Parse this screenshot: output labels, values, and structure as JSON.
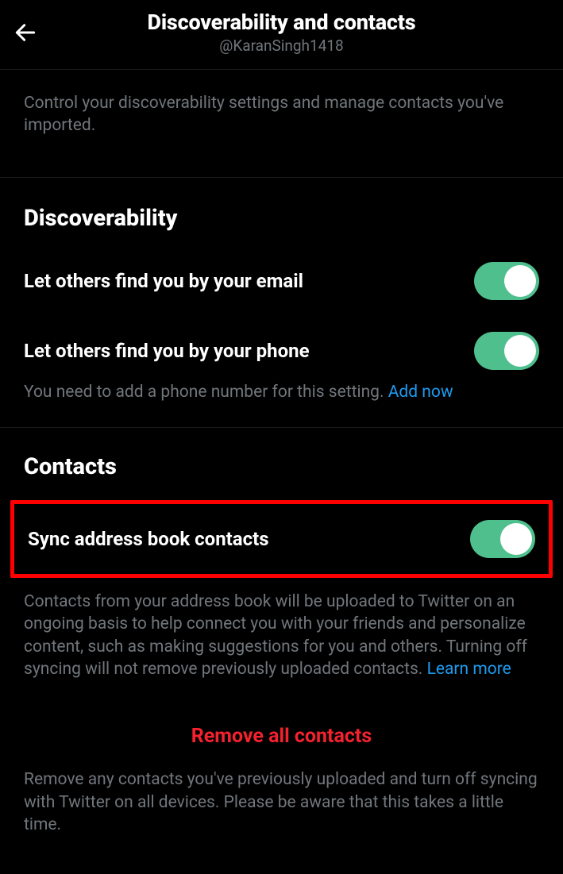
{
  "header": {
    "title": "Discoverability and contacts",
    "subtitle": "@KaranSingh1418"
  },
  "intro": "Control your discoverability settings and manage contacts you've imported.",
  "discoverability": {
    "title": "Discoverability",
    "email": {
      "label": "Let others find you by your email",
      "enabled": true
    },
    "phone": {
      "label": "Let others find you by your phone",
      "enabled": true,
      "helper_prefix": "You need to add a phone number for this setting. ",
      "helper_link": "Add now"
    }
  },
  "contacts": {
    "title": "Contacts",
    "sync": {
      "label": "Sync address book contacts",
      "enabled": true,
      "helper_prefix": "Contacts from your address book will be uploaded to Twitter on an ongoing basis to help connect you with your friends and personalize content, such as making suggestions for you and others. Turning off syncing will not remove previously uploaded contacts. ",
      "helper_link": "Learn more"
    },
    "remove": {
      "label": "Remove all contacts",
      "helper": "Remove any contacts you've previously uploaded and turn off syncing with Twitter on all devices. Please be aware that this takes a little time."
    }
  }
}
